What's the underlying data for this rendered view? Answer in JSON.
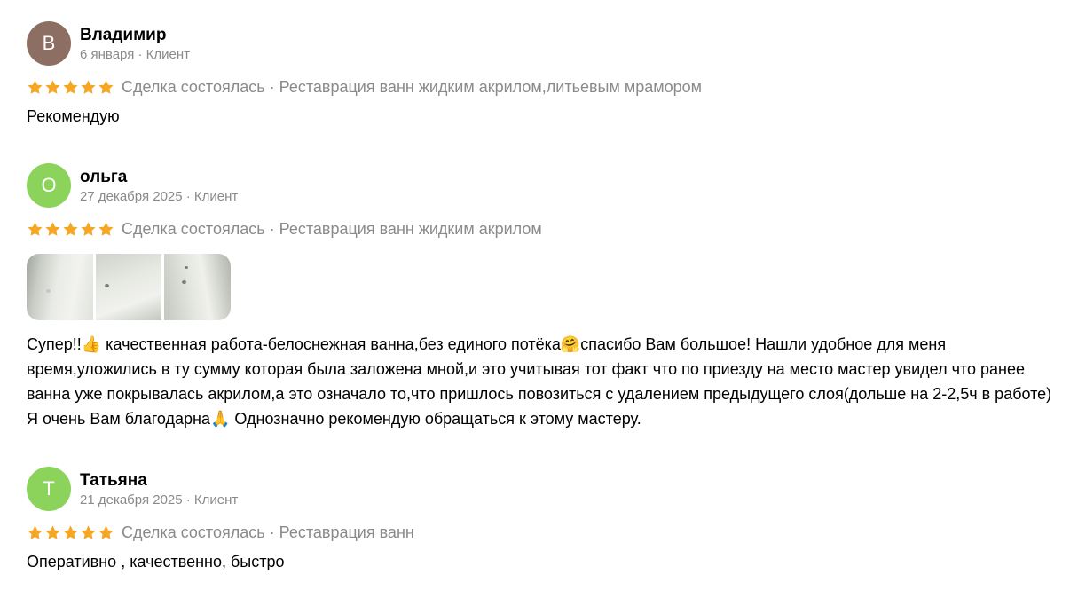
{
  "colors": {
    "star": "#f5a623",
    "meta_text": "#8a8a8a",
    "avatar_brown": "#8d6e63",
    "avatar_green": "#8bd35a"
  },
  "reviews": [
    {
      "avatar_letter": "В",
      "avatar_color": "#8d6e63",
      "name": "Владимир",
      "meta": "6 января · Клиент",
      "rating": 5,
      "deal": "Сделка состоялась · Реставрация ванн жидким акрилом,литьевым мрамором",
      "text": "Рекомендую"
    },
    {
      "avatar_letter": "О",
      "avatar_color": "#8bd35a",
      "name": "ольга",
      "meta": "27 декабря 2025 · Клиент",
      "rating": 5,
      "deal": "Сделка состоялась · Реставрация ванн жидким акрилом",
      "photos": [
        "bathtub-photo-1",
        "bathtub-photo-2",
        "bathtub-photo-3"
      ],
      "text": "Супер!!👍 качественная работа-белоснежная ванна,без единого потёка🤗спасибо Вам большое! Нашли удобное для меня время,уложились в ту сумму которая была заложена мной,и это учитывая тот факт что по приезду на место мастер увидел что ранее ванна уже покрывалась акрилом,а это означало то,что пришлось повозиться с удалением предыдущего слоя(дольше на 2-2,5ч в работе) Я очень Вам благодарна🙏 Однозначно рекомендую обращаться к этому мастеру."
    },
    {
      "avatar_letter": "Т",
      "avatar_color": "#8bd35a",
      "name": "Татьяна",
      "meta": "21 декабря 2025 · Клиент",
      "rating": 5,
      "deal": "Сделка состоялась · Реставрация ванн",
      "text": "Оперативно , качественно, быстро"
    }
  ]
}
